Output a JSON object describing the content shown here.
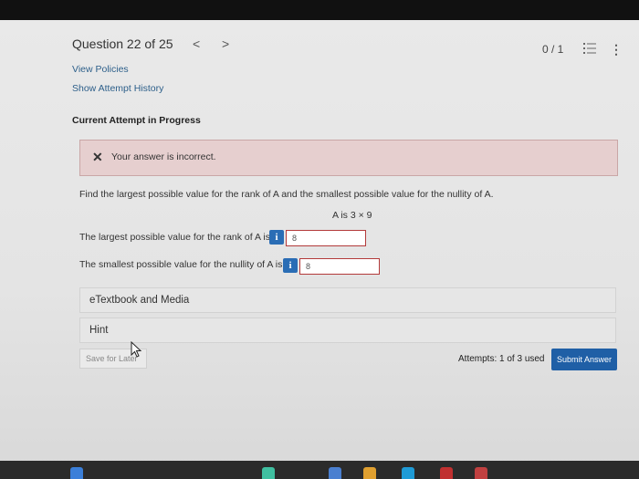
{
  "header": {
    "question_label": "Question 22 of 25",
    "prev_arrow": "<",
    "next_arrow": ">",
    "score": "0 / 1",
    "more_glyph": "⋮"
  },
  "links": {
    "view_policies": "View Policies",
    "show_attempt_history": "Show Attempt History"
  },
  "attempt": {
    "title": "Current Attempt in Progress"
  },
  "feedback": {
    "icon": "✕",
    "message": "Your answer is incorrect."
  },
  "question": {
    "prompt": "Find the largest possible value for the rank of A and the smallest possible value for the nullity of A.",
    "given": "A is 3 × 9"
  },
  "answers": [
    {
      "label": "The largest possible value for the rank of A is",
      "info": "i",
      "value": "8"
    },
    {
      "label": "The smallest possible value for the nullity of A is",
      "info": "i",
      "value": "8"
    }
  ],
  "sections": {
    "etextbook": "eTextbook and Media",
    "hint": "Hint"
  },
  "footer": {
    "save_label": "Save for Later",
    "attempts": "Attempts: 1 of 3 used",
    "submit_label": "Submit Answer"
  },
  "colors": {
    "accent": "#1f5fa6",
    "error_bg": "#e6cfcf",
    "error_border": "#b33a3a",
    "link": "#2d5f8a"
  },
  "icons": [
    "list-icon",
    "more-vertical-icon",
    "close-icon",
    "info-icon",
    "mouse-cursor-icon"
  ]
}
